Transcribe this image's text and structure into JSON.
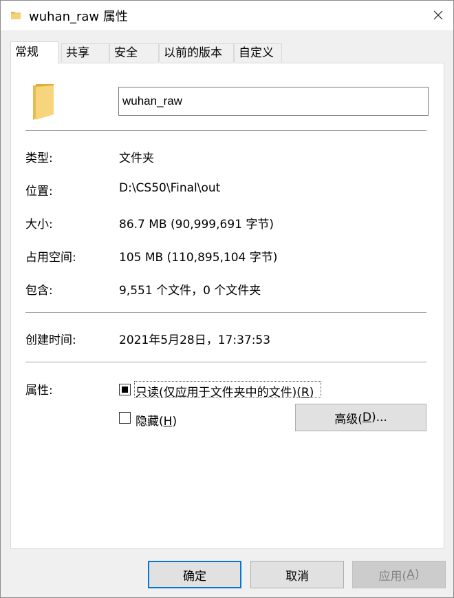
{
  "window": {
    "title": "wuhan_raw 属性",
    "close_icon": "close-icon"
  },
  "tabs": [
    {
      "label": "常规",
      "active": true
    },
    {
      "label": "共享"
    },
    {
      "label": "安全"
    },
    {
      "label": "以前的版本"
    },
    {
      "label": "自定义"
    }
  ],
  "general": {
    "folder_icon": "folder-icon",
    "name_value": "wuhan_raw",
    "type_label": "类型:",
    "type_value": "文件夹",
    "location_label": "位置:",
    "location_value": "D:\\CS50\\Final\\out",
    "size_label": "大小:",
    "size_value": "86.7 MB (90,999,691 字节)",
    "size_on_disk_label": "占用空间:",
    "size_on_disk_value": "105 MB (110,895,104 字节)",
    "contains_label": "包含:",
    "contains_value": "9,551 个文件，0 个文件夹",
    "created_label": "创建时间:",
    "created_value": "2021年5月28日，17:37:53",
    "attributes_label": "属性:",
    "readonly_label_main": "只读(仅应用于文件夹中的文件)(",
    "readonly_key": "R",
    "readonly_close": ")",
    "readonly_state": "indeterminate",
    "hidden_label_main": "隐藏(",
    "hidden_key": "H",
    "hidden_close": ")",
    "hidden_checked": false,
    "advanced_main": "高级(",
    "advanced_key": "D",
    "advanced_close": ")..."
  },
  "footer": {
    "ok_label": "确定",
    "cancel_label": "取消",
    "apply_main": "应用(",
    "apply_key": "A",
    "apply_close": ")"
  }
}
